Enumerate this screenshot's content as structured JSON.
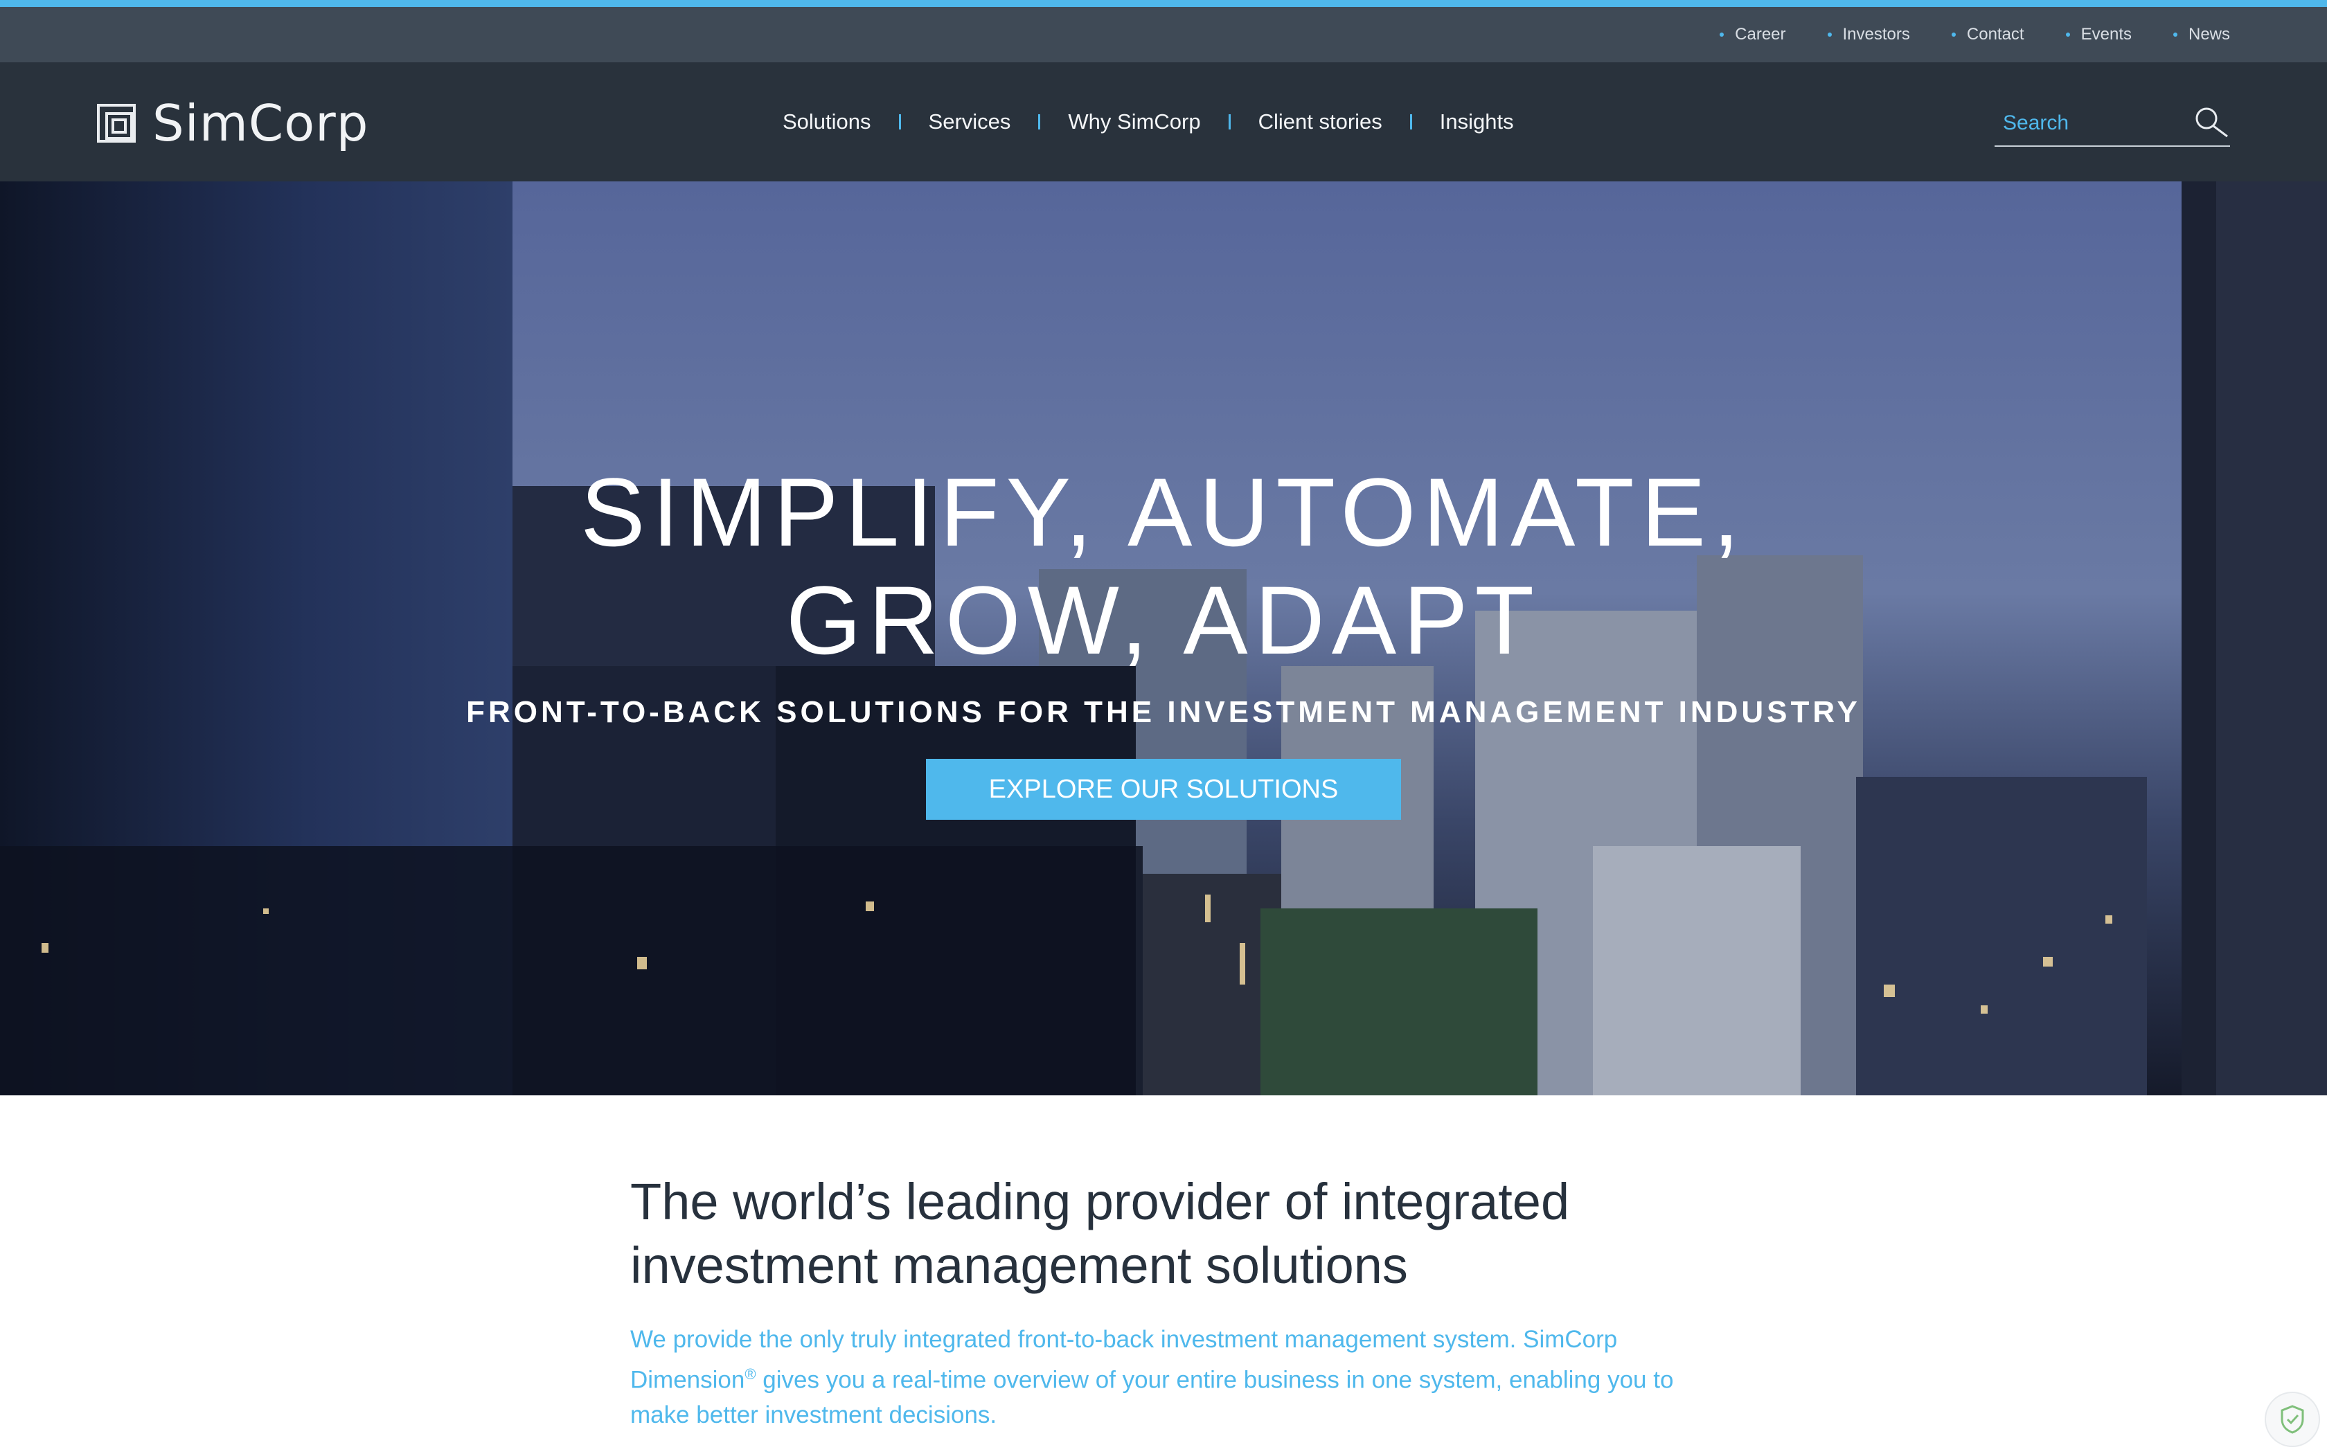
{
  "utility_nav": {
    "links": [
      {
        "label": "Career"
      },
      {
        "label": "Investors"
      },
      {
        "label": "Contact"
      },
      {
        "label": "Events"
      },
      {
        "label": "News"
      }
    ]
  },
  "header": {
    "logo_text": "SimCorp",
    "nav": [
      {
        "label": "Solutions"
      },
      {
        "label": "Services"
      },
      {
        "label": "Why SimCorp"
      },
      {
        "label": "Client stories"
      },
      {
        "label": "Insights"
      }
    ],
    "search": {
      "placeholder": "Search",
      "icon": "search-icon"
    }
  },
  "hero": {
    "title_line1": "SIMPLIFY, AUTOMATE,",
    "title_line2": "GROW, ADAPT",
    "subtitle": "FRONT-TO-BACK SOLUTIONS FOR THE INVESTMENT MANAGEMENT INDUSTRY",
    "cta_label": "EXPLORE OUR SOLUTIONS"
  },
  "intro": {
    "heading_line1": "The world’s leading provider of integrated",
    "heading_line2": "investment management solutions",
    "body_part1": "We provide the only truly integrated front-to-back investment management system. SimCorp Dimension",
    "body_sup": "®",
    "body_part2": " gives you a real-time overview of your entire business in one system, enabling you to make better investment decisions."
  },
  "colors": {
    "accent": "#4fb8ec",
    "nav_bg": "#29323c",
    "utility_bg": "#3f4a56",
    "heading_text": "#27313d"
  }
}
